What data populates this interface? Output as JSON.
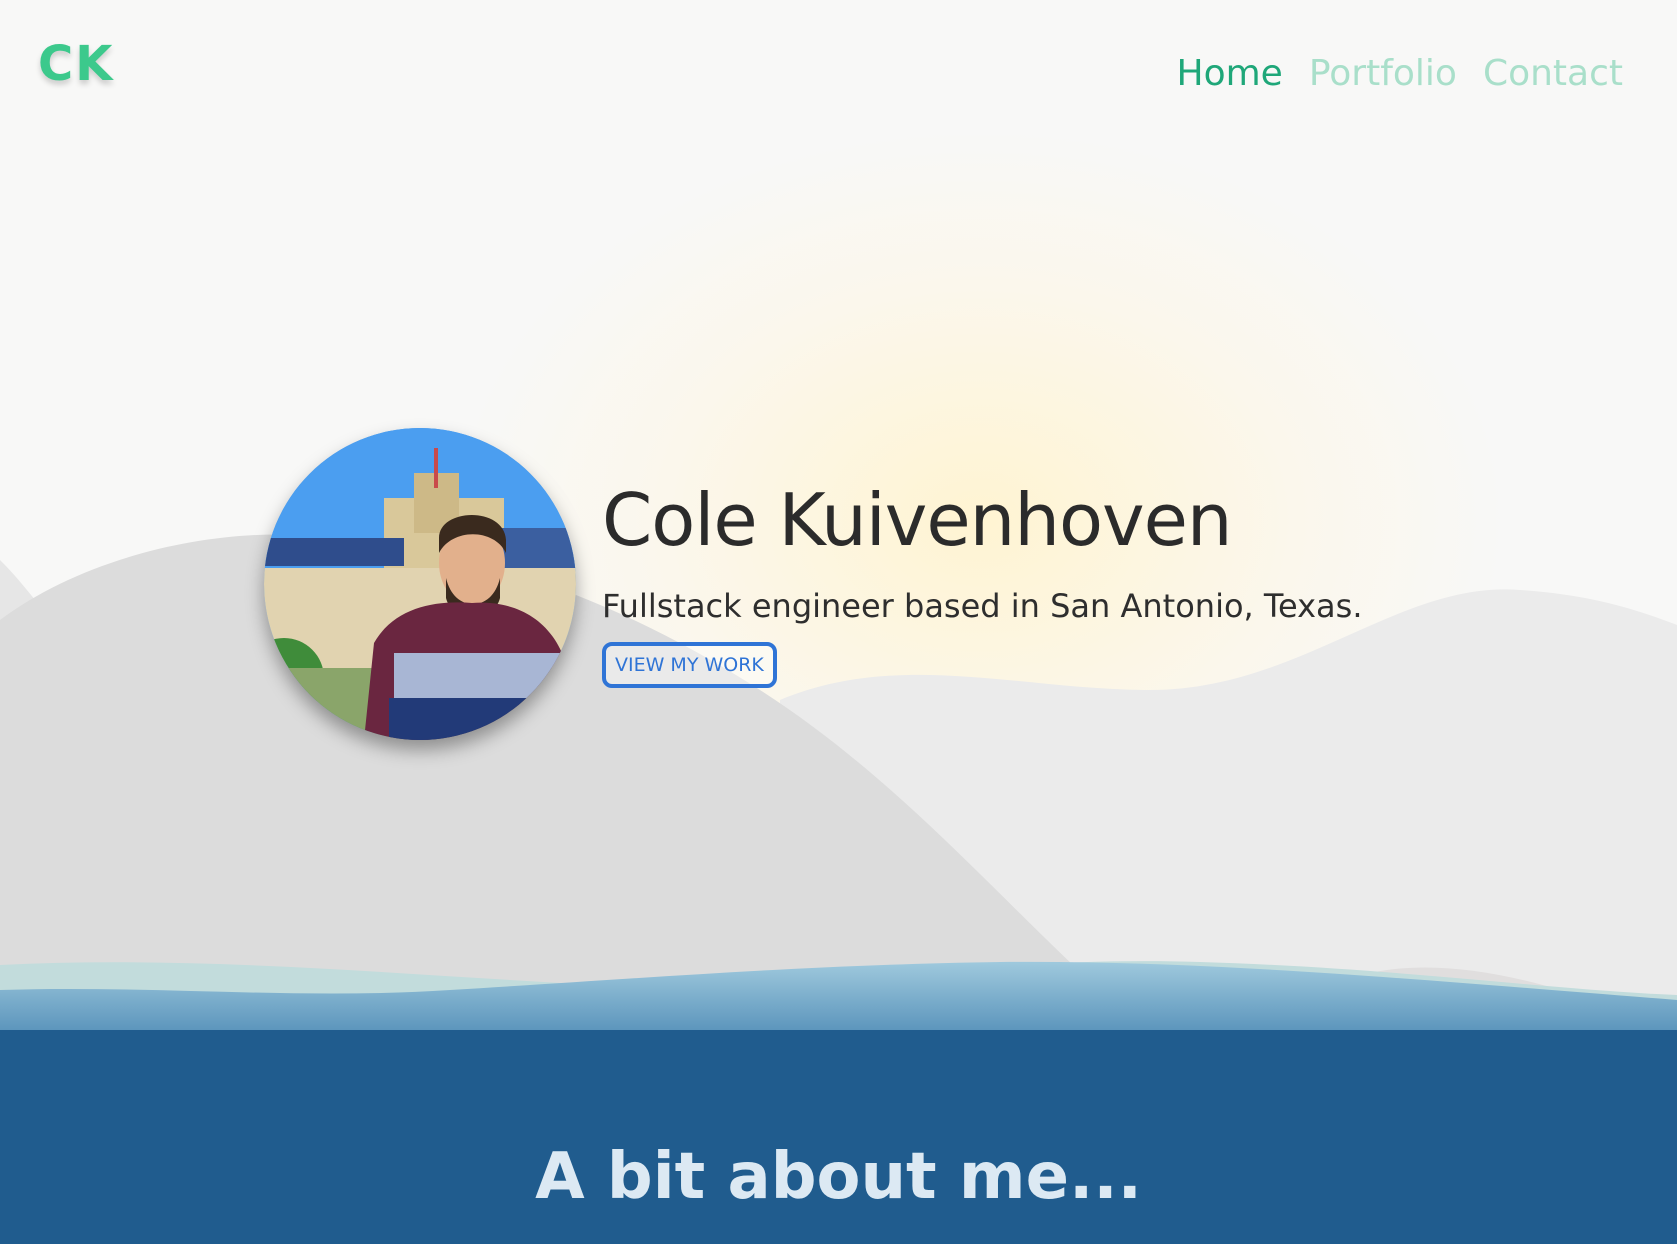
{
  "header": {
    "logo": "CK",
    "nav": [
      {
        "label": "Home",
        "active": true
      },
      {
        "label": "Portfolio",
        "active": false
      },
      {
        "label": "Contact",
        "active": false
      }
    ]
  },
  "hero": {
    "name": "Cole Kuivenhoven",
    "subtitle": "Fullstack engineer based in San Antonio, Texas.",
    "cta_label": "VIEW MY WORK"
  },
  "about": {
    "title": "A bit about me..."
  },
  "colors": {
    "accent_green": "#3cc98c",
    "nav_inactive": "#a9dfca",
    "button_blue": "#2f74d6",
    "section_blue": "#205c8e"
  }
}
